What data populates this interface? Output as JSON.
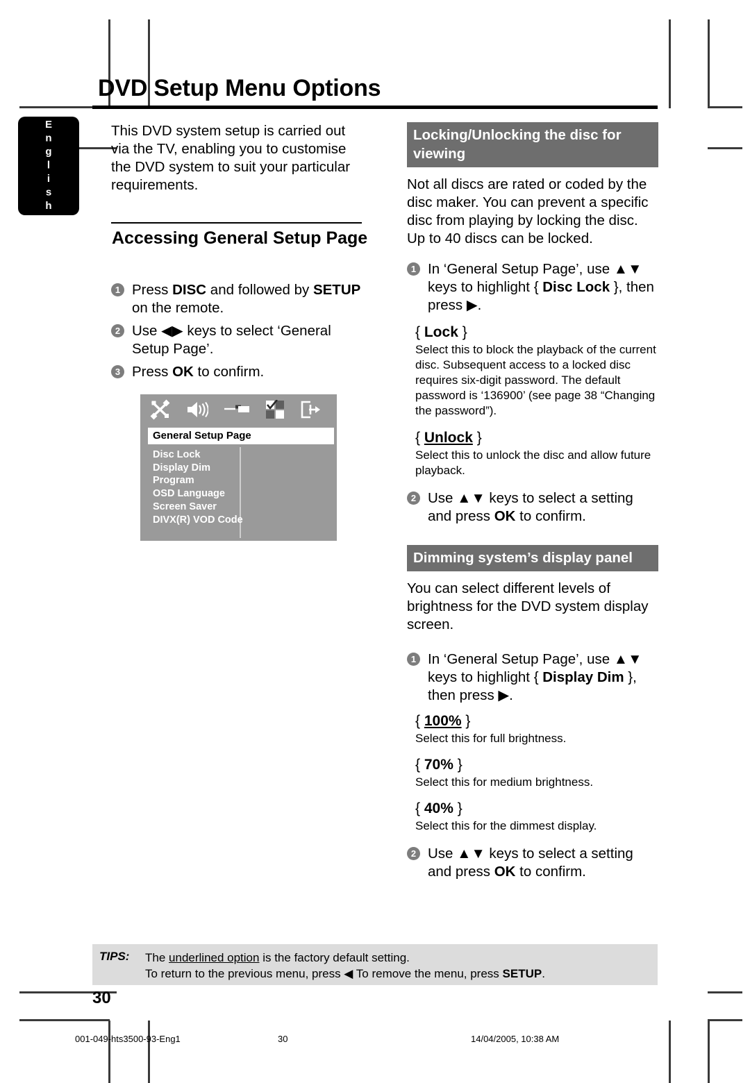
{
  "language_tab": {
    "label": "English"
  },
  "header": {
    "title": "DVD Setup Menu Options"
  },
  "left_column": {
    "intro": "This DVD system setup is carried out via the TV, enabling you to customise the DVD system to suit your particular requirements.",
    "section_heading": "Accessing General Setup Page",
    "steps": [
      {
        "num": "1",
        "html": "Press <b>DISC</b> and followed by <b>SETUP</b> on the remote."
      },
      {
        "num": "2",
        "html": "Use ◀▶ keys to select ‘General Setup Page’."
      },
      {
        "num": "3",
        "html": "Press <b>OK</b> to confirm."
      }
    ]
  },
  "osd_menu": {
    "icons": [
      "tools-icon",
      "speaker-icon",
      "slider-icon",
      "video-grid-icon",
      "exit-icon"
    ],
    "title": "General Setup Page",
    "items": [
      "Disc Lock",
      "Display Dim",
      "Program",
      "OSD Language",
      "Screen Saver",
      "DIVX(R) VOD Code"
    ]
  },
  "right_column": {
    "section_lock": {
      "band": "Locking/Unlocking the disc for viewing",
      "intro": "Not all discs are rated or coded by the disc maker. You can prevent a specific disc from playing by locking the disc.  Up to 40 discs can be locked.",
      "step1": {
        "num": "1",
        "html": "In ‘General Setup Page’, use ▲▼ keys to highlight { <b>Disc Lock</b> }, then press ▶."
      },
      "options": [
        {
          "label_html": "{ <b>Lock</b> }",
          "desc": "Select this to block the playback of the current disc.  Subsequent access to a locked disc requires six-digit password. The default password is ‘136900’ (see page 38 “Changing the password”)."
        },
        {
          "label_html": "{ <b><u>Unlock</u></b> }",
          "desc": "Select this to unlock the disc and allow future playback."
        }
      ],
      "step2": {
        "num": "2",
        "html": "Use ▲▼ keys to select a setting and press <b>OK</b> to confirm."
      }
    },
    "section_dim": {
      "band": "Dimming system’s display panel",
      "intro": "You can select different levels of brightness for the DVD system display screen.",
      "step1": {
        "num": "1",
        "html": "In ‘General Setup Page’, use ▲▼ keys to highlight { <b>Display Dim</b> }, then press ▶."
      },
      "options": [
        {
          "label_html": "{ <b><u>100%</u></b> }",
          "desc": "Select this for full brightness."
        },
        {
          "label_html": "{ <b>70%</b> }",
          "desc": "Select this for medium brightness."
        },
        {
          "label_html": "{ <b>40%</b> }",
          "desc": "Select this for the dimmest display."
        }
      ],
      "step2": {
        "num": "2",
        "html": "Use ▲▼ keys to select a setting and press <b>OK</b> to confirm."
      }
    }
  },
  "tips": {
    "label": "TIPS:",
    "line1_html": "The <u>underlined option</u> is the factory default setting.",
    "line2_html": "To return to the previous menu, press ◀  To remove the menu, press <b>SETUP</b>."
  },
  "folio": "30",
  "print_footer": {
    "file": "001-049-hts3500-93-Eng1",
    "page": "30",
    "date": "14/04/2005, 10:38 AM"
  },
  "colors": {
    "band_gray": "#6e6e6e",
    "tips_gray": "#dcdcdc",
    "osd_gray": "#9a9a9a",
    "bullet_gray": "#7d7d7d"
  }
}
